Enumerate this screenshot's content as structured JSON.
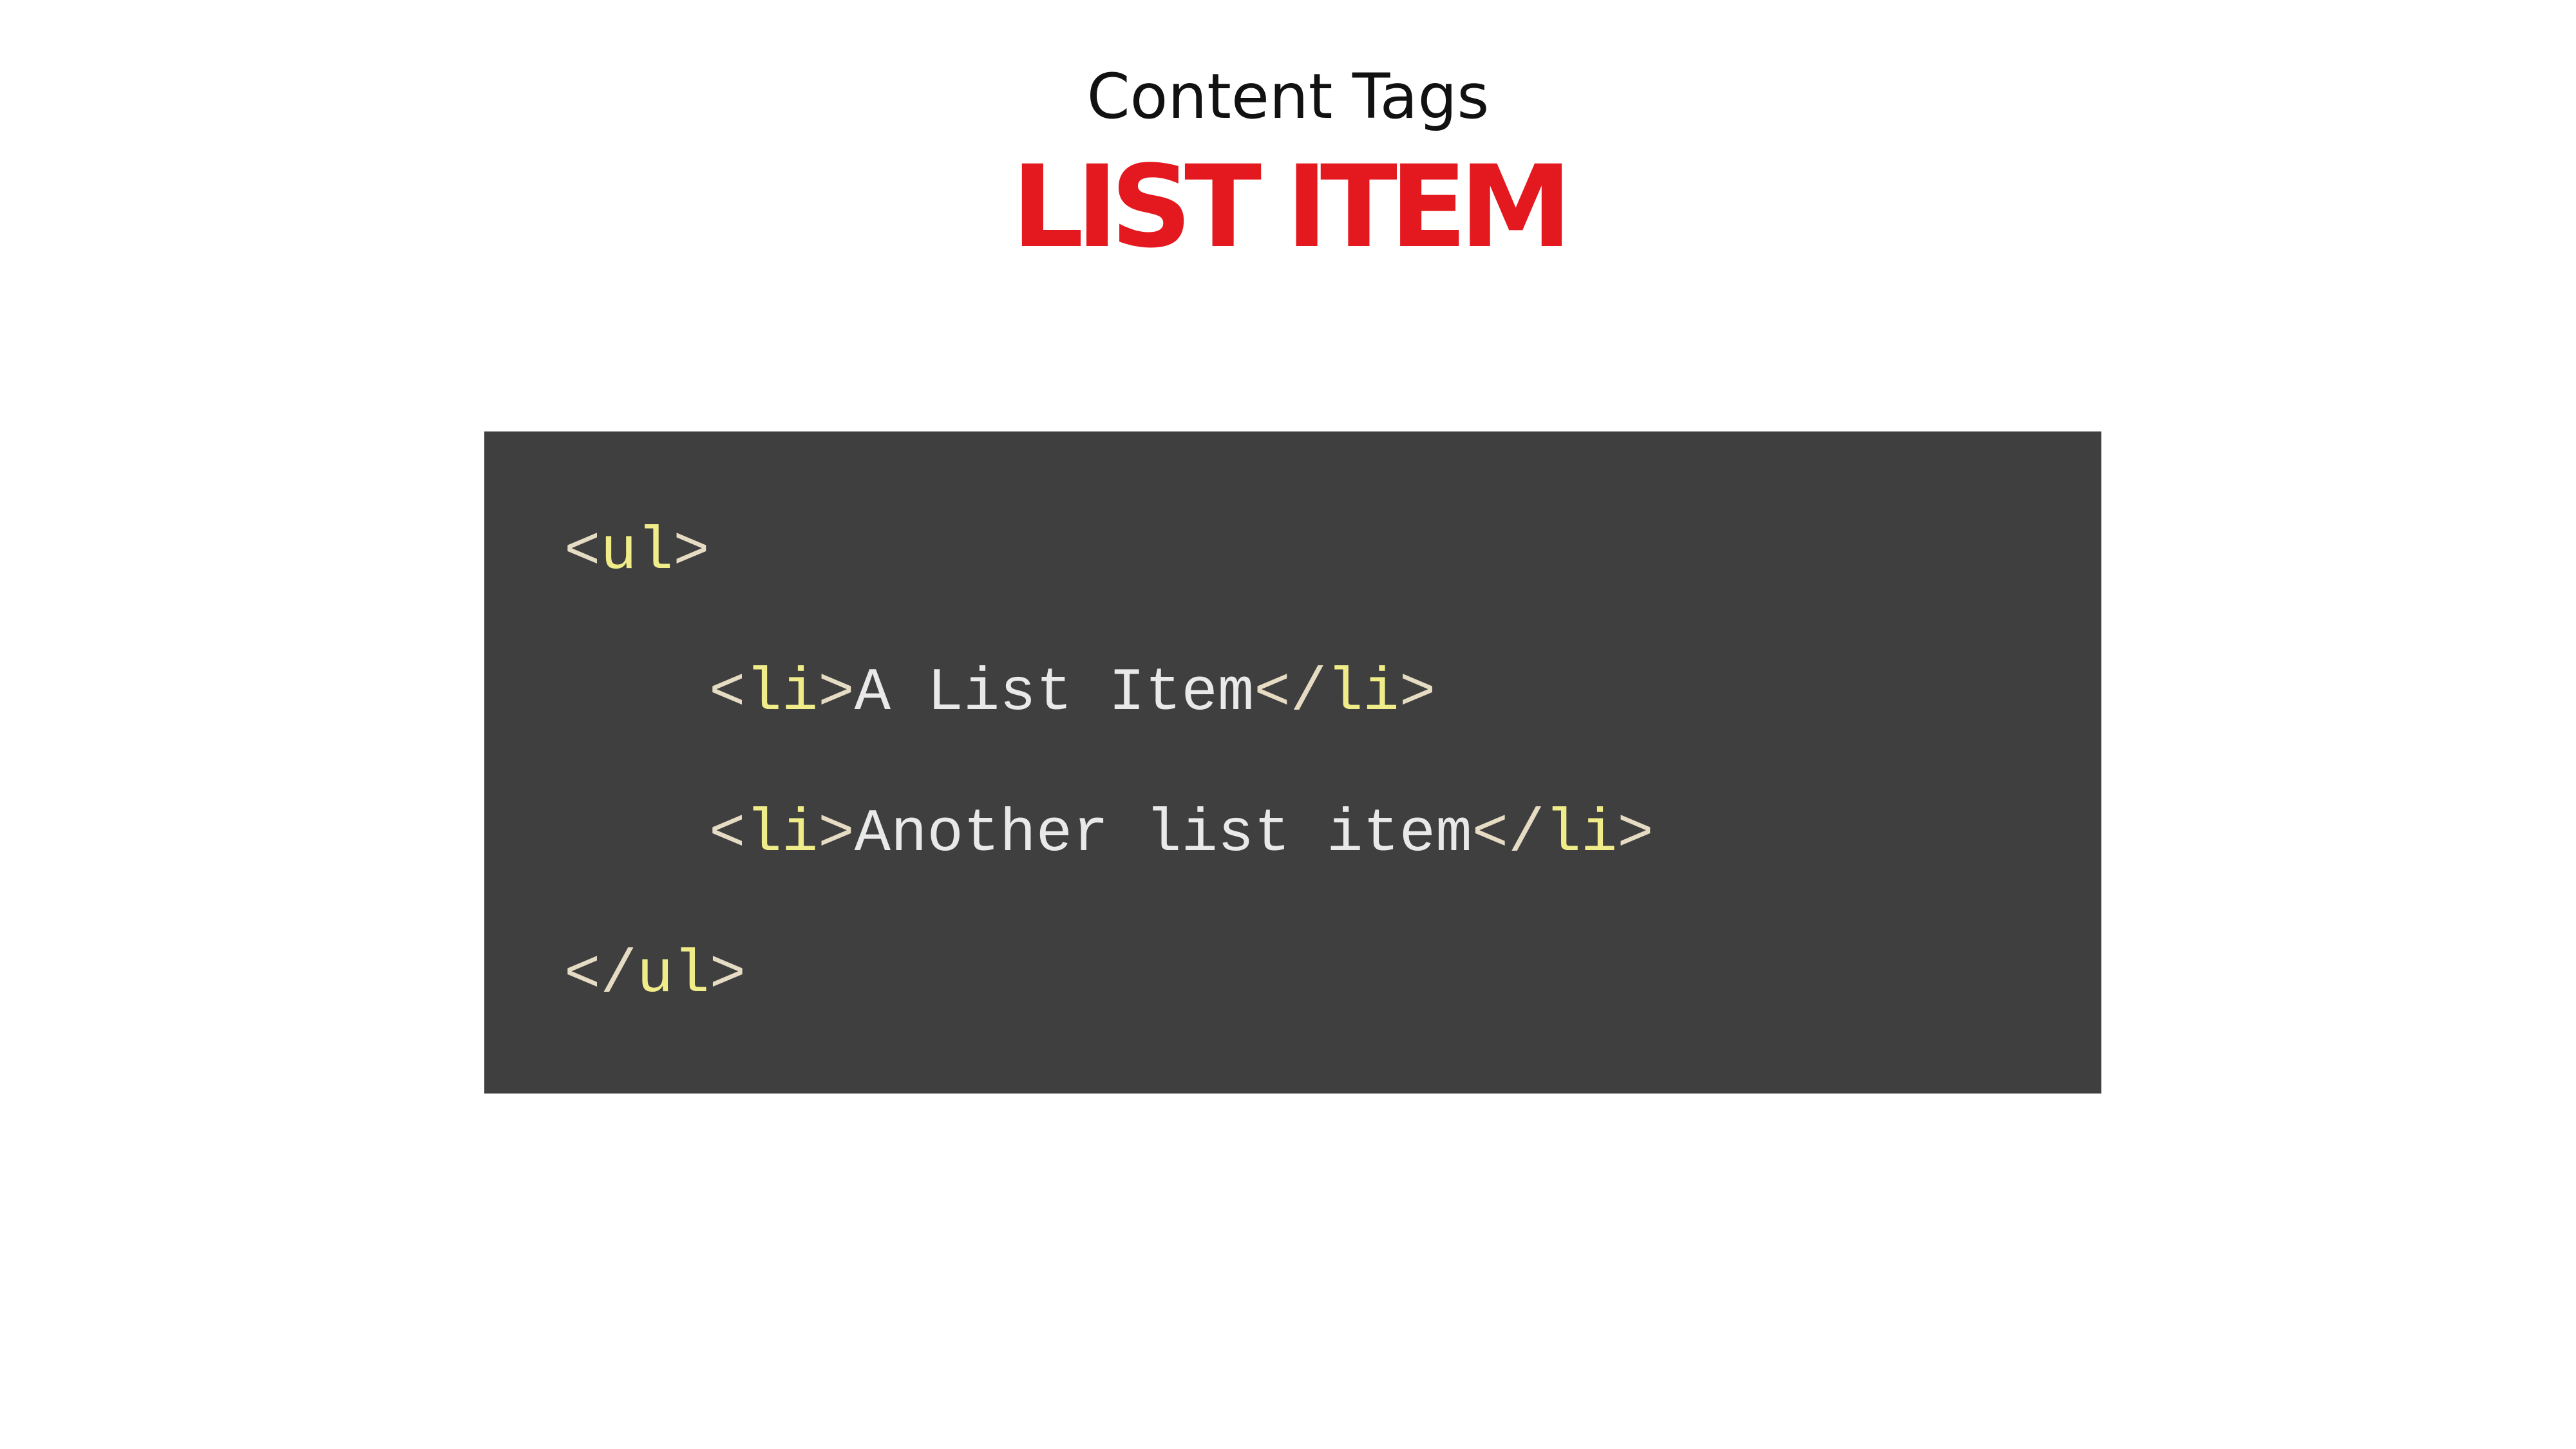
{
  "slide": {
    "subtitle": "Content Tags",
    "title": "LIST ITEM"
  },
  "code": {
    "lines": [
      [
        {
          "kind": "punct",
          "text": "<"
        },
        {
          "kind": "tag",
          "text": "ul"
        },
        {
          "kind": "punct",
          "text": ">"
        }
      ],
      [
        {
          "kind": "punct",
          "text": "<"
        },
        {
          "kind": "tag",
          "text": "li"
        },
        {
          "kind": "punct",
          "text": ">"
        },
        {
          "kind": "text",
          "text": "A List Item"
        },
        {
          "kind": "punct",
          "text": "</"
        },
        {
          "kind": "tag",
          "text": "li"
        },
        {
          "kind": "punct",
          "text": ">"
        }
      ],
      [
        {
          "kind": "punct",
          "text": "<"
        },
        {
          "kind": "tag",
          "text": "li"
        },
        {
          "kind": "punct",
          "text": ">"
        },
        {
          "kind": "text",
          "text": "Another list item"
        },
        {
          "kind": "punct",
          "text": "</"
        },
        {
          "kind": "tag",
          "text": "li"
        },
        {
          "kind": "punct",
          "text": ">"
        }
      ],
      [
        {
          "kind": "punct",
          "text": "</"
        },
        {
          "kind": "tag",
          "text": "ul"
        },
        {
          "kind": "punct",
          "text": ">"
        }
      ]
    ]
  },
  "colors": {
    "title": "#e4191f",
    "panel_background": "#3f3f3f",
    "tag_name": "#f0ec8a",
    "bracket": "#e6dcc4",
    "content_text": "#e9e9e9"
  }
}
